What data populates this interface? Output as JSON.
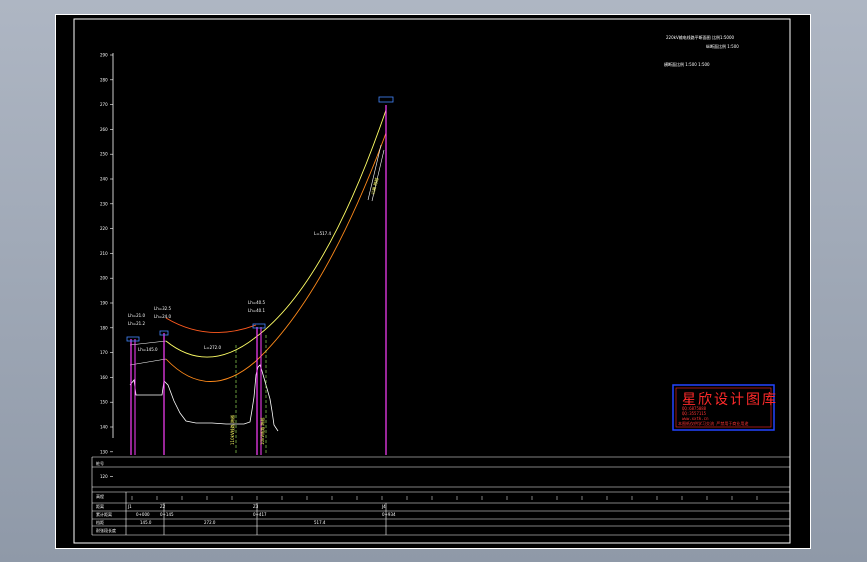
{
  "title_block": {
    "line1": "220kV输电线路平断面图 比例1:5000",
    "line2": "纵断面比例 1:500",
    "line3": "横断面比例  1:500  1:500"
  },
  "elevation_axis": {
    "ticks": [
      "290",
      "280",
      "270",
      "260",
      "250",
      "240",
      "230",
      "220",
      "210",
      "200",
      "190",
      "180",
      "170",
      "160",
      "150",
      "140",
      "130",
      "120"
    ]
  },
  "towers": [
    {
      "id": "t1",
      "label_top": "Lh=21.0",
      "label_bottom": "Lh=21.2",
      "name": "J1"
    },
    {
      "id": "t2",
      "label_top": "Lh=32.5",
      "label_bottom": "Lh=24.0",
      "name": "Z2"
    },
    {
      "id": "t3",
      "label_top": "Lh=40.5",
      "label_bottom": "Lh=40.1",
      "name": "Z3"
    },
    {
      "id": "t4",
      "label_top": "",
      "label_bottom": "",
      "name": "J4"
    }
  ],
  "span_labels": {
    "span1": "Lh=145.0",
    "span2": "L=272.0",
    "span3": "L=517.4"
  },
  "rotated_labels": {
    "label_a": "110kV线路 跨越",
    "label_b": "10kV线路 跨越",
    "label_c": "公路 跨越"
  },
  "bottom_table": {
    "row_labels": [
      "桩号",
      "高程",
      "距离",
      "累计距离",
      "档距",
      "耐张段长度"
    ],
    "cells": {
      "c1": "J1",
      "c2": "Z2",
      "c3": "Z3",
      "c4": "J4",
      "d1": "145.0",
      "d2": "272.0",
      "d3": "517.4",
      "e1": "0+000",
      "e2": "0+145",
      "e3": "0+417",
      "e4": "0+934"
    }
  },
  "watermark": {
    "title": "星欣设计图库",
    "line1": "QQ:6875088",
    "line2": "QQ:3557115",
    "line3": "www.xxtk.cn",
    "line4": "本图纸仅供学习交流 严禁用于商业用途"
  },
  "colors": {
    "upper_conductor": "#ff5a1f",
    "middle_conductor": "#ffff66",
    "lower_conductor": "#ff8a1a",
    "tower": "#ff40ff",
    "ground": "#ffffff",
    "crossing": "#aaff66",
    "watermark": "#ff2a2a",
    "watermark_border": "#2244ff"
  }
}
